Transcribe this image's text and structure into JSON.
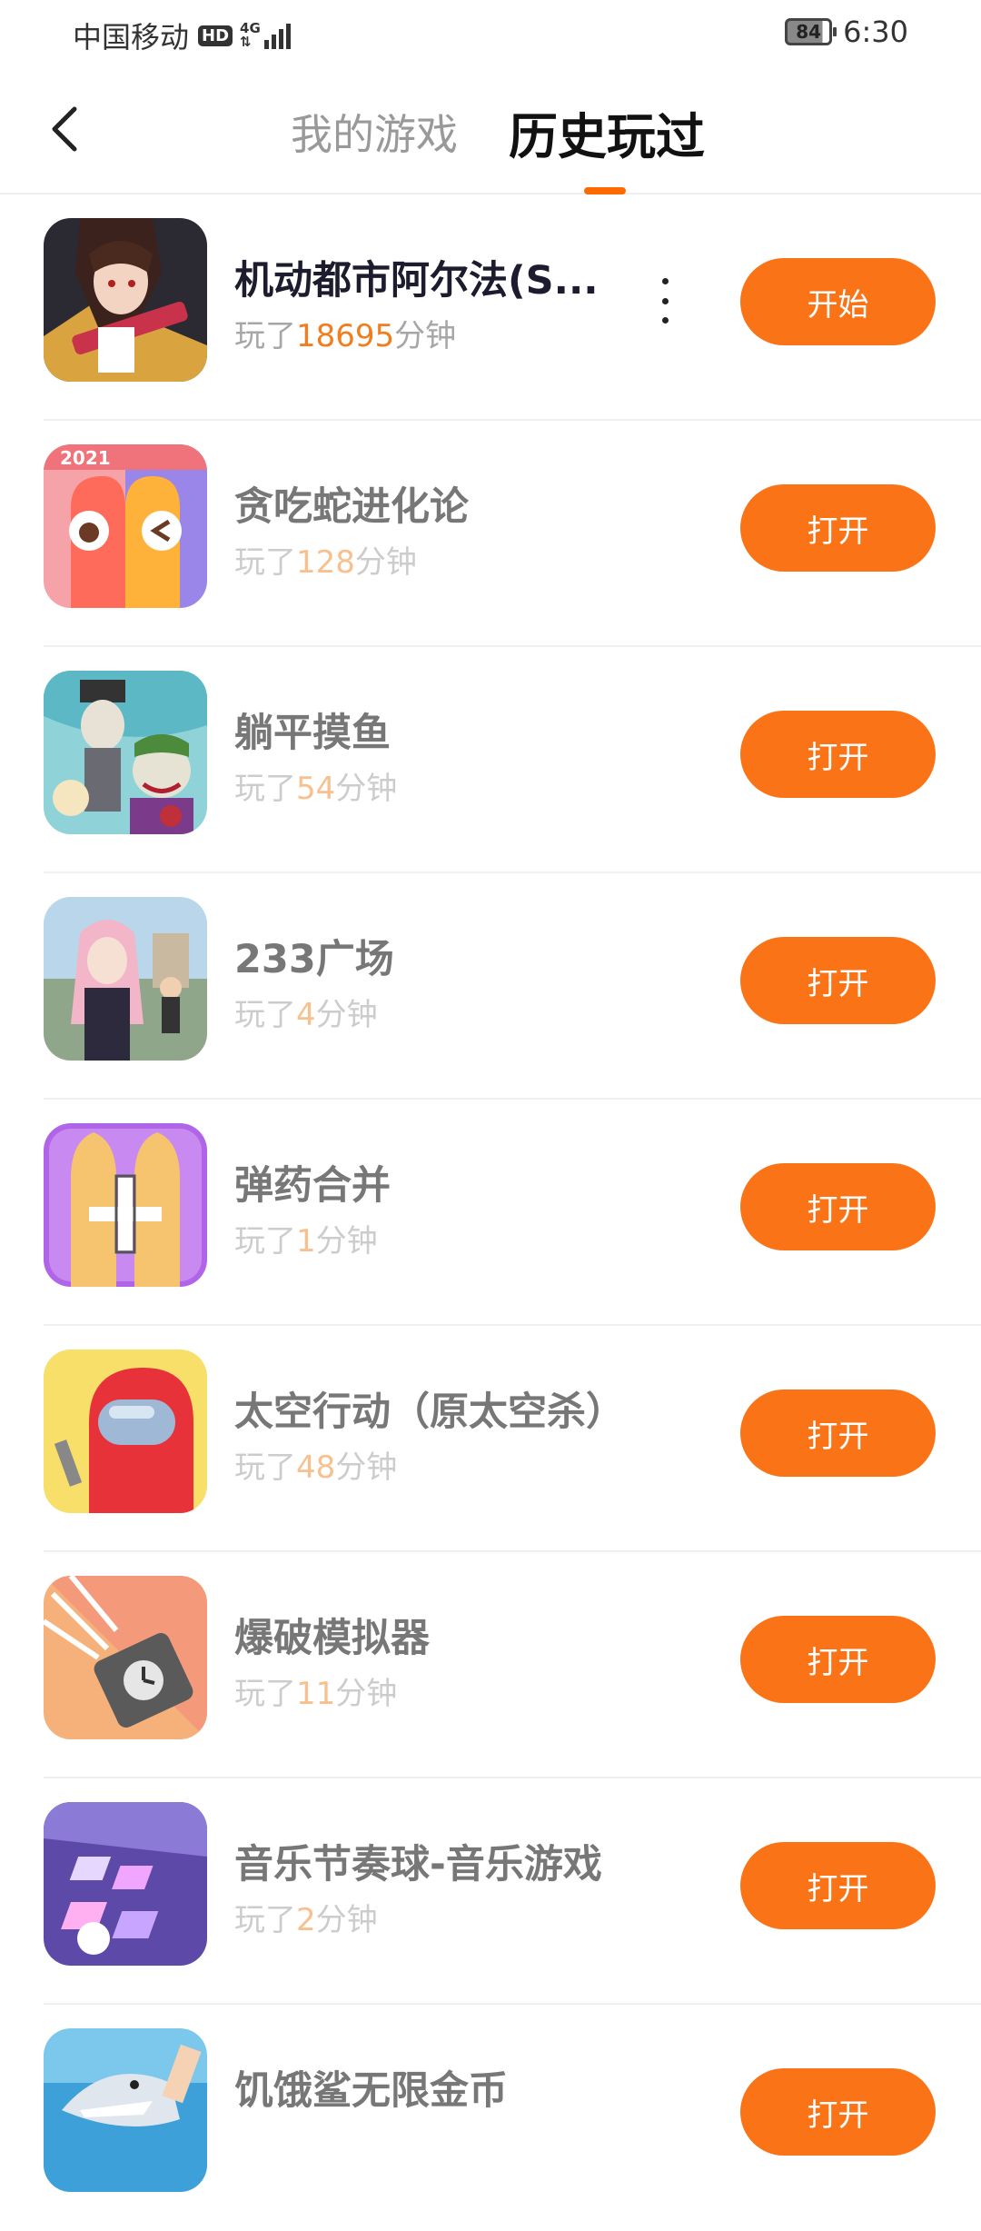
{
  "status_bar": {
    "carrier": "中国移动",
    "hd": "HD",
    "network": "4G",
    "battery": "84",
    "time": "6:30"
  },
  "header": {
    "tabs": [
      {
        "label": "我的游戏",
        "active": false
      },
      {
        "label": "历史玩过",
        "active": true
      }
    ],
    "accent_color": "#ff6a00"
  },
  "games": [
    {
      "title": "机动都市阿尔法(S...",
      "played_prefix": "玩了",
      "minutes": "18695",
      "played_suffix": "分钟",
      "action": "开始",
      "icon": "anime-girl-gun-icon"
    },
    {
      "title": "贪吃蛇进化论",
      "played_prefix": "玩了",
      "minutes": "128",
      "played_suffix": "分钟",
      "action": "打开",
      "icon": "snake-icon"
    },
    {
      "title": "躺平摸鱼",
      "played_prefix": "玩了",
      "minutes": "54",
      "played_suffix": "分钟",
      "action": "打开",
      "icon": "cartoon-characters-icon"
    },
    {
      "title": "233广场",
      "played_prefix": "玩了",
      "minutes": "4",
      "played_suffix": "分钟",
      "action": "打开",
      "icon": "anime-plaza-icon"
    },
    {
      "title": "弹药合并",
      "played_prefix": "玩了",
      "minutes": "1",
      "played_suffix": "分钟",
      "action": "打开",
      "icon": "bullets-plus-icon"
    },
    {
      "title": "太空行动（原太空杀）",
      "played_prefix": "玩了",
      "minutes": "48",
      "played_suffix": "分钟",
      "action": "打开",
      "icon": "crewmate-icon"
    },
    {
      "title": "爆破模拟器",
      "played_prefix": "玩了",
      "minutes": "11",
      "played_suffix": "分钟",
      "action": "打开",
      "icon": "dynamite-icon"
    },
    {
      "title": "音乐节奏球-音乐游戏",
      "played_prefix": "玩了",
      "minutes": "2",
      "played_suffix": "分钟",
      "action": "打开",
      "icon": "music-tiles-icon"
    },
    {
      "title": "饥饿鲨无限金币",
      "played_prefix": "",
      "minutes": "",
      "played_suffix": "",
      "action": "打开",
      "icon": "shark-icon"
    }
  ],
  "colors": {
    "button": "#fb7317",
    "minutes_highlight": "#f07d1e"
  }
}
